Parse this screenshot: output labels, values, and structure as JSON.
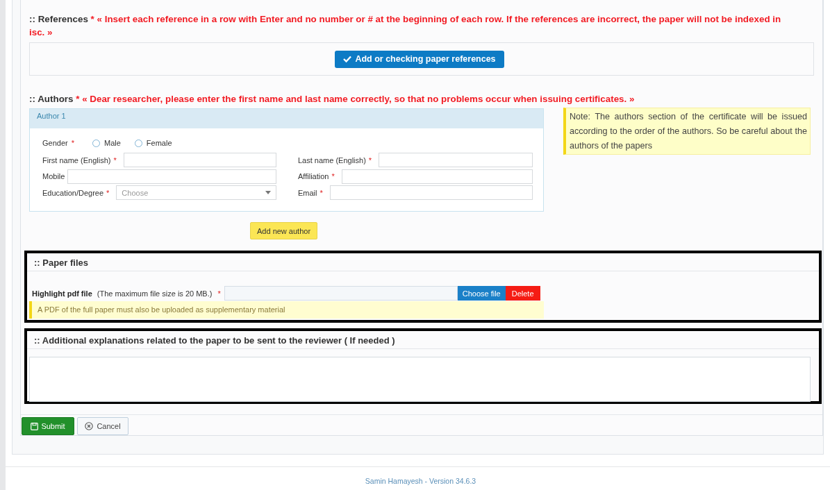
{
  "references": {
    "title": ":: References",
    "note": "* « Insert each reference in a row with Enter and no number or # at the beginning of each row. If the references are incorrect, the paper will not be indexed in isc. »",
    "button": "Add or checking paper references"
  },
  "authors": {
    "title": ":: Authors",
    "note": "* « Dear researcher, please enter the first name and last name correctly, so that no problems occur when issuing certificates. »",
    "card_title": "Author 1",
    "gender": {
      "label": "Gender",
      "mark": "*",
      "options": [
        {
          "label": "Male",
          "selected": false
        },
        {
          "label": "Female",
          "selected": false
        }
      ]
    },
    "fields": [
      {
        "label": "First name (English)",
        "mark": "*",
        "kind": "text"
      },
      {
        "label": "Last name (English)",
        "mark": "*",
        "kind": "text"
      },
      {
        "label": "Mobile",
        "kind": "text"
      },
      {
        "label": "Affiliation",
        "mark": "*",
        "kind": "text"
      },
      {
        "label": "Education/Degree",
        "mark": "*",
        "kind": "select",
        "placeholder": "Choose"
      },
      {
        "label": "Email",
        "mark": "*",
        "kind": "text"
      }
    ],
    "side_note": "Note: The authors section of the certificate will be issued according to the order of the authors. So be careful about the authors of the papers",
    "add_button": "Add new author"
  },
  "paper_files": {
    "title": ":: Paper files",
    "label": "Highlight pdf file",
    "hint": "(The maximum file size is 20 MB.)",
    "mark": "*",
    "choose_button": "Choose file",
    "delete_button": "Delete",
    "note": "A PDF of the full paper must also be uploaded as supplementary material"
  },
  "additional": {
    "title": ":: Additional explanations related to the paper to be sent to the reviewer ( If needed )"
  },
  "buttons": {
    "submit": "Submit",
    "cancel": "Cancel"
  },
  "footer": "Samin Hamayesh - Version 34.6.3"
}
